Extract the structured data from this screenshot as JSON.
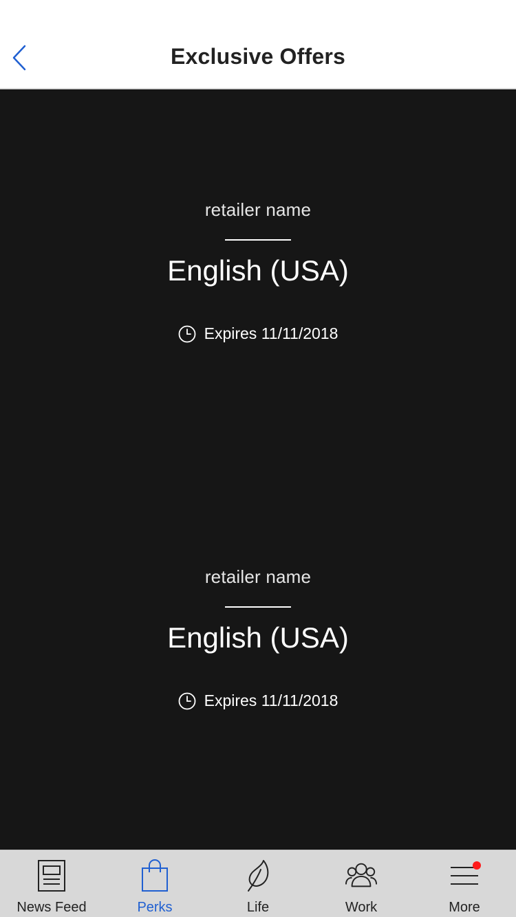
{
  "header": {
    "title": "Exclusive Offers",
    "back_icon": "chevron-left-icon"
  },
  "offers": [
    {
      "retailer": "retailer name",
      "title": "English (USA)",
      "expiry": "Expires 11/11/2018",
      "icon": "clock-icon"
    },
    {
      "retailer": "retailer name",
      "title": "English (USA)",
      "expiry": "Expires 11/11/2018",
      "icon": "clock-icon"
    }
  ],
  "tabbar": {
    "items": [
      {
        "label": "News Feed",
        "icon": "newspaper-icon",
        "active": false
      },
      {
        "label": "Perks",
        "icon": "shopping-bag-icon",
        "active": true
      },
      {
        "label": "Life",
        "icon": "leaf-icon",
        "active": false
      },
      {
        "label": "Work",
        "icon": "people-icon",
        "active": false
      },
      {
        "label": "More",
        "icon": "menu-icon",
        "active": false,
        "notification": true
      }
    ]
  },
  "colors": {
    "accent": "#1f5fd1",
    "background_dark": "#161616",
    "tabbar_bg": "#d8d8d8",
    "notification_dot": "#ff1a1a"
  }
}
